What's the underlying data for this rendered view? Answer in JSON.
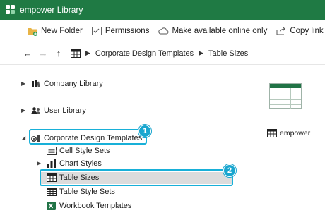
{
  "window": {
    "title": "empower Library"
  },
  "toolbar": {
    "new_folder": "New Folder",
    "permissions": "Permissions",
    "make_available": "Make available online only",
    "copy_link": "Copy link"
  },
  "nav": {
    "back_icon": "back-arrow-icon",
    "forward_icon": "forward-arrow-icon",
    "up_icon": "up-arrow-icon",
    "breadcrumb": [
      "Corporate Design Templates",
      "Table Sizes"
    ]
  },
  "tree": {
    "company_library": "Company Library",
    "user_library": "User Library",
    "corporate_design_templates": "Corporate Design Templates",
    "cell_style_sets": "Cell Style Sets",
    "chart_styles": "Chart Styles",
    "table_sizes": "Table Sizes",
    "table_style_sets": "Table Style Sets",
    "workbook_templates": "Workbook Templates"
  },
  "callouts": {
    "one": "1",
    "two": "2"
  },
  "content": {
    "file_name": "empower"
  },
  "colors": {
    "titlebar": "#1f7a44",
    "highlight": "#18b0d8",
    "selected_row": "#dcdcdc",
    "excel_green": "#217346"
  }
}
